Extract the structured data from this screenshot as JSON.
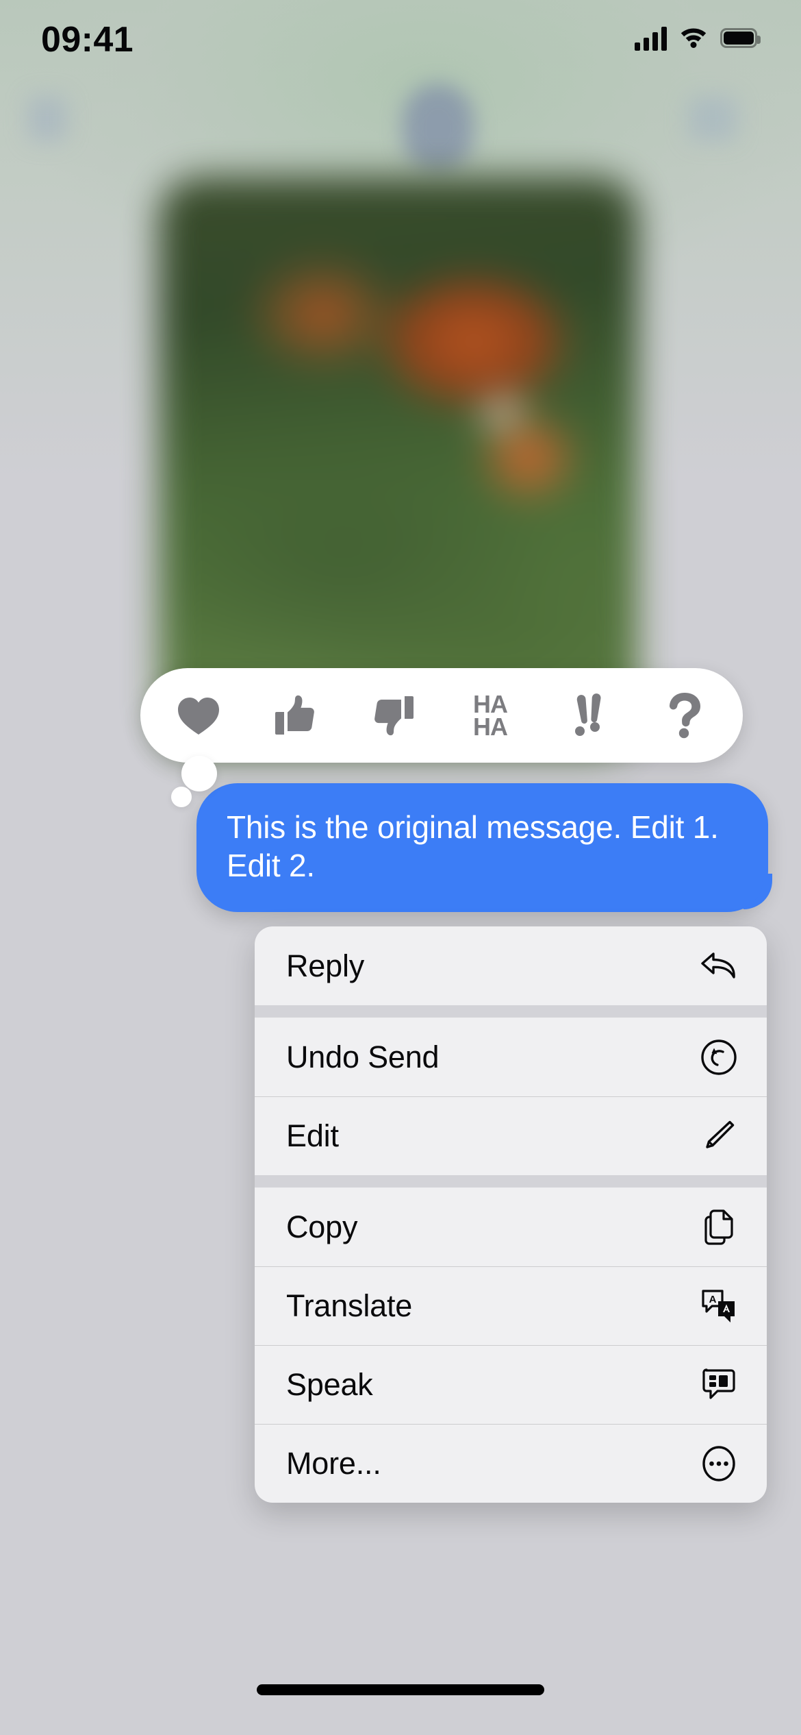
{
  "status_bar": {
    "time": "09:41",
    "cellular_icon": "signal-bars-icon",
    "wifi_icon": "wifi-icon",
    "battery_icon": "battery-full-icon"
  },
  "conversation": {
    "background_note": "blurred photo attachment and navigation bar behind the focused overlay",
    "nav": {
      "back_icon": "back-chevron-icon",
      "avatar_icon": "contact-avatar",
      "info_icon": "info-icon"
    },
    "attachment": {
      "name": "photo-attachment",
      "state": "blurred"
    }
  },
  "tapback_bar": {
    "name": "tapback-reaction-bar",
    "reactions": [
      {
        "id": "heart",
        "icon": "heart-icon",
        "label": "Love"
      },
      {
        "id": "thumbsup",
        "icon": "thumbs-up-icon",
        "label": "Like"
      },
      {
        "id": "thumbsdown",
        "icon": "thumbs-down-icon",
        "label": "Dislike"
      },
      {
        "id": "haha",
        "icon": "haha-icon",
        "label": "Haha",
        "line1": "HA",
        "line2": "HA"
      },
      {
        "id": "exclaim",
        "icon": "double-exclamation-icon",
        "label": "Emphasize",
        "glyph": "!!"
      },
      {
        "id": "question",
        "icon": "question-mark-icon",
        "label": "Question",
        "glyph": "?"
      }
    ],
    "icon_color": "#7c7c80",
    "background_color": "#ffffff"
  },
  "message": {
    "text": "This is the original message. Edit 1. Edit 2.",
    "sender": "outgoing",
    "bubble_color": "#3c7df6",
    "text_color": "#ffffff"
  },
  "context_menu": {
    "groups": [
      {
        "items": [
          {
            "label": "Reply",
            "icon": "reply-arrow-icon"
          }
        ]
      },
      {
        "items": [
          {
            "label": "Undo Send",
            "icon": "undo-circle-arrow-icon"
          },
          {
            "label": "Edit",
            "icon": "pencil-icon"
          }
        ]
      },
      {
        "items": [
          {
            "label": "Copy",
            "icon": "copy-documents-icon"
          },
          {
            "label": "Translate",
            "icon": "translate-bubbles-icon"
          },
          {
            "label": "Speak",
            "icon": "speak-bubble-icon"
          },
          {
            "label": "More...",
            "icon": "ellipsis-circle-icon"
          }
        ]
      }
    ],
    "background_color": "#f0f0f2",
    "label_color": "#0a0a0c"
  },
  "home_indicator": {
    "name": "home-indicator",
    "color": "#000000"
  }
}
